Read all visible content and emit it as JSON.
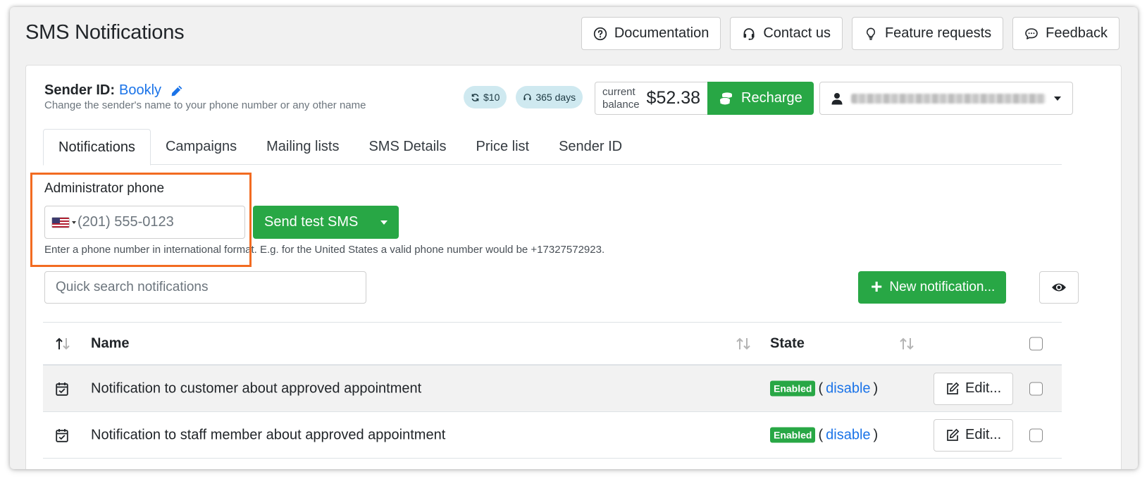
{
  "page": {
    "title": "SMS Notifications"
  },
  "top_actions": [
    {
      "label": "Documentation",
      "icon": "question-circle-icon"
    },
    {
      "label": "Contact us",
      "icon": "headset-icon"
    },
    {
      "label": "Feature requests",
      "icon": "lightbulb-icon"
    },
    {
      "label": "Feedback",
      "icon": "comment-icon"
    }
  ],
  "sender": {
    "label": "Sender ID:",
    "name": "Bookly",
    "help": "Change the sender's name to your phone number or any other name"
  },
  "badges": {
    "auto_recharge": "$10",
    "support": "365 days"
  },
  "balance": {
    "caption_line1": "current",
    "caption_line2": "balance",
    "amount": "$52.38",
    "recharge_label": "Recharge"
  },
  "tabs": [
    "Notifications",
    "Campaigns",
    "Mailing lists",
    "SMS Details",
    "Price list",
    "Sender ID"
  ],
  "admin_phone": {
    "label": "Administrator phone",
    "placeholder": "(201) 555-0123",
    "country": "US",
    "help": "Enter a phone number in international format. E.g. for the United States a valid phone number would be +17327572923.",
    "send_label": "Send test SMS"
  },
  "search": {
    "placeholder": "Quick search notifications"
  },
  "new_notification_label": "New notification...",
  "table": {
    "headers": {
      "name": "Name",
      "state": "State"
    },
    "rows": [
      {
        "name": "Notification to customer about approved appointment",
        "state": "Enabled",
        "toggle": "disable",
        "edit": "Edit..."
      },
      {
        "name": "Notification to staff member about approved appointment",
        "state": "Enabled",
        "toggle": "disable",
        "edit": "Edit..."
      }
    ]
  },
  "colors": {
    "primary_green": "#28a745",
    "link_blue": "#1a73e8",
    "highlight_orange": "#f26b21",
    "pill_bg": "#cfe9f0"
  }
}
